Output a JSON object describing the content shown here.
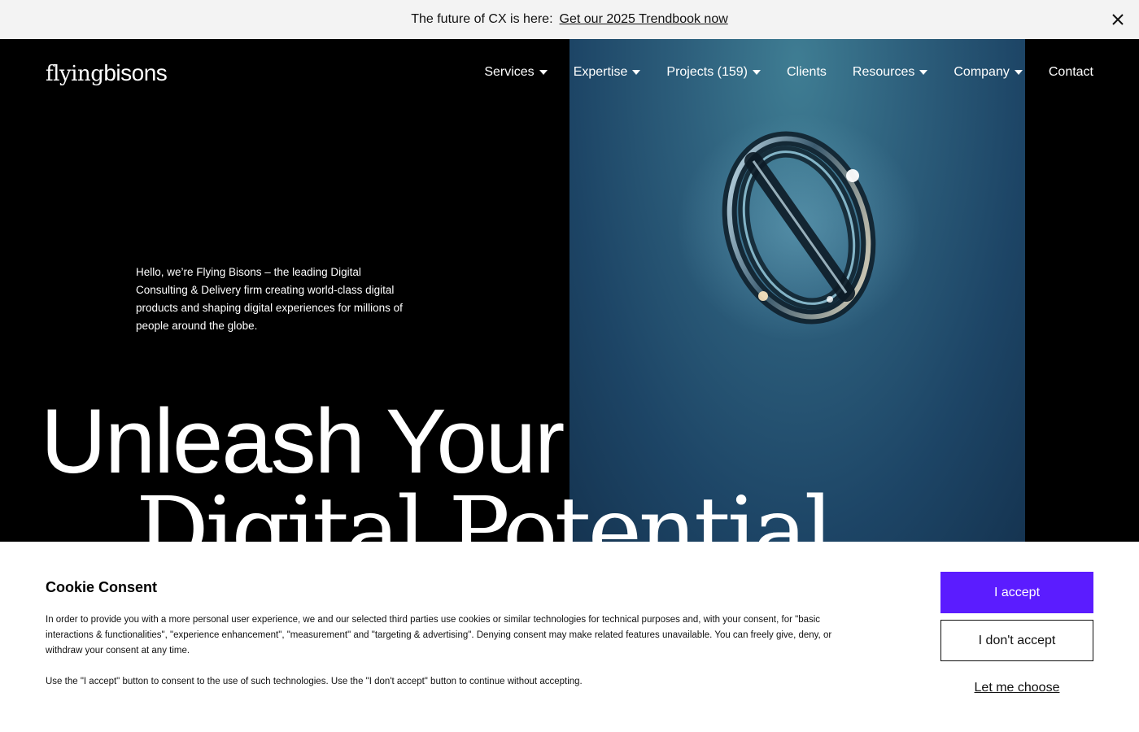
{
  "banner": {
    "text": "The future of CX is here:",
    "link": "Get our 2025 Trendbook now",
    "close_icon": "close-icon"
  },
  "logo": {
    "light": "flying",
    "bold": "bisons"
  },
  "nav": {
    "items": [
      {
        "label": "Services",
        "dropdown": true
      },
      {
        "label": "Expertise",
        "dropdown": true
      },
      {
        "label": "Projects (159)",
        "dropdown": true
      },
      {
        "label": "Clients",
        "dropdown": false
      },
      {
        "label": "Resources",
        "dropdown": true
      },
      {
        "label": "Company",
        "dropdown": true
      },
      {
        "label": "Contact",
        "dropdown": false
      }
    ]
  },
  "hero": {
    "intro": "Hello, we’re Flying Bisons – the leading Digital Consulting & Delivery firm creating world-class digital products and shaping digital experiences for millions of people around the globe.",
    "headline_line1": "Unleash Your",
    "headline_line2": "Digital Potential"
  },
  "cookie": {
    "title": "Cookie Consent",
    "paragraph1": "In order to provide you with a more personal user experience, we and our selected third parties use cookies or similar technologies for technical purposes and, with your consent, for \"basic interactions & functionalities\", \"experience enhancement\", \"measurement\" and \"targeting & advertising\". Denying consent may make related features unavailable. You can freely give, deny, or withdraw your consent at any time.",
    "paragraph2": "Use the \"I accept\" button to consent to the use of such technologies. Use the \"I don't accept\" button to continue without accepting.",
    "accept_label": "I accept",
    "decline_label": "I don't accept",
    "choose_label": "Let me choose"
  },
  "colors": {
    "accent": "#5b1cff",
    "banner_bg": "#f3f3f3",
    "hero_bg": "#000000"
  }
}
